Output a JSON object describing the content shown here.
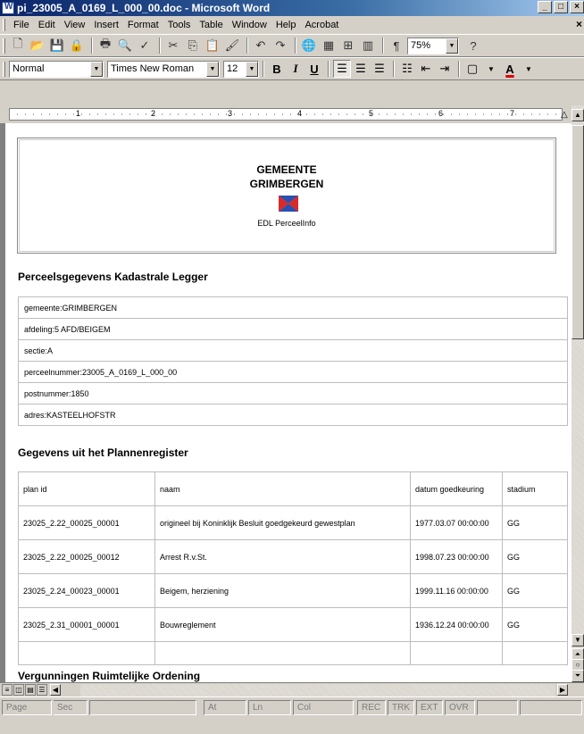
{
  "window": {
    "title": "pi_23005_A_0169_L_000_00.doc - Microsoft Word",
    "min": "_",
    "max": "□",
    "close": "×"
  },
  "menu": [
    "File",
    "Edit",
    "View",
    "Insert",
    "Format",
    "Tools",
    "Table",
    "Window",
    "Help",
    "Acrobat"
  ],
  "toolbar": {
    "zoom": "75%",
    "help": "?"
  },
  "format_bar": {
    "style": "Normal",
    "font": "Times New Roman",
    "size": "12"
  },
  "ruler": {
    "numbers": [
      "1",
      "2",
      "3",
      "4",
      "5",
      "6",
      "7"
    ]
  },
  "document": {
    "org_line1": "GEMEENTE",
    "org_line2": "GRIMBERGEN",
    "org_sub": "EDL PerceelInfo",
    "section1_title": "Perceelsgegevens Kadastrale Legger",
    "parcel_rows": [
      "gemeente:GRIMBERGEN",
      "afdeling:5 AFD/BEIGEM",
      "sectie:A",
      "perceelnummer:23005_A_0169_L_000_00",
      "postnummer:1850",
      "adres:KASTEELHOFSTR"
    ],
    "section2_title": "Gegevens uit het Plannenregister",
    "plan_headers": [
      "plan id",
      "naam",
      "datum goedkeuring",
      "stadium"
    ],
    "plan_rows": [
      {
        "id": "23025_2.22_00025_00001",
        "naam": "origineel bij Koninklijk Besluit goedgekeurd gewestplan",
        "datum": "1977.03.07 00:00:00",
        "stadium": "GG"
      },
      {
        "id": "23025_2.22_00025_00012",
        "naam": "Arrest R.v.St.",
        "datum": "1998.07.23 00:00:00",
        "stadium": "GG"
      },
      {
        "id": "23025_2.24_00023_00001",
        "naam": "Beigem, herziening",
        "datum": "1999.11.16 00:00:00",
        "stadium": "GG"
      },
      {
        "id": "23025_2.31_00001_00001",
        "naam": "Bouwreglement",
        "datum": "1936.12.24 00:00:00",
        "stadium": "GG"
      }
    ],
    "section3_title": "Vergunningen Ruimtelijke Ordening"
  },
  "status": {
    "page": "Page",
    "sec": "Sec",
    "at": "At",
    "ln": "Ln",
    "col": "Col",
    "rec": "REC",
    "trk": "TRK",
    "ext": "EXT",
    "ovr": "OVR"
  }
}
